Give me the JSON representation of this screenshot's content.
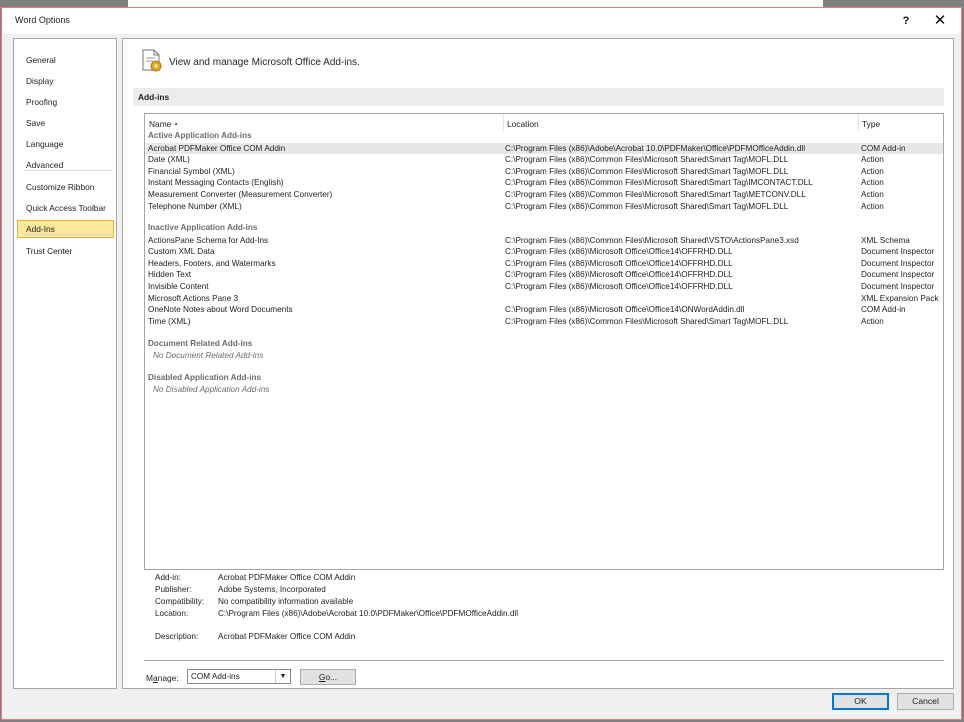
{
  "window": {
    "title": "Word Options",
    "help_glyph": "?",
    "close_glyph": "✕"
  },
  "nav": {
    "items": [
      {
        "label": "General",
        "selected": false
      },
      {
        "label": "Display",
        "selected": false
      },
      {
        "label": "Proofing",
        "selected": false
      },
      {
        "label": "Save",
        "selected": false
      },
      {
        "label": "Language",
        "selected": false
      },
      {
        "label": "Advanced",
        "selected": false
      },
      {
        "label": "Customize Ribbon",
        "selected": false
      },
      {
        "label": "Quick Access Toolbar",
        "selected": false
      },
      {
        "label": "Add-Ins",
        "selected": true
      },
      {
        "label": "Trust Center",
        "selected": false
      }
    ]
  },
  "header": {
    "text": "View and manage Microsoft Office Add-ins.",
    "icon": "addins-gear-document-icon"
  },
  "section": {
    "title": "Add-ins"
  },
  "list": {
    "columns": {
      "name": "Name",
      "sort_glyph": "▲",
      "location": "Location",
      "type": "Type"
    },
    "groups": [
      {
        "title": "Active Application Add-ins",
        "rows": [
          {
            "name": "Acrobat PDFMaker Office COM Addin",
            "location": "C:\\Program Files (x86)\\Adobe\\Acrobat 10.0\\PDFMaker\\Office\\PDFMOfficeAddin.dll",
            "type": "COM Add-in",
            "selected": true
          },
          {
            "name": "Date (XML)",
            "location": "C:\\Program Files (x86)\\Common Files\\Microsoft Shared\\Smart Tag\\MOFL.DLL",
            "type": "Action"
          },
          {
            "name": "Financial Symbol (XML)",
            "location": "C:\\Program Files (x86)\\Common Files\\Microsoft Shared\\Smart Tag\\MOFL.DLL",
            "type": "Action"
          },
          {
            "name": "Instant Messaging Contacts (English)",
            "location": "C:\\Program Files (x86)\\Common Files\\Microsoft Shared\\Smart Tag\\IMCONTACT.DLL",
            "type": "Action"
          },
          {
            "name": "Measurement Converter (Measurement Converter)",
            "location": "C:\\Program Files (x86)\\Common Files\\Microsoft Shared\\Smart Tag\\METCONV.DLL",
            "type": "Action"
          },
          {
            "name": "Telephone Number (XML)",
            "location": "C:\\Program Files (x86)\\Common Files\\Microsoft Shared\\Smart Tag\\MOFL.DLL",
            "type": "Action"
          }
        ]
      },
      {
        "title": "Inactive Application Add-ins",
        "rows": [
          {
            "name": "ActionsPane Schema for Add-Ins",
            "location": "C:\\Program Files (x86)\\Common Files\\Microsoft Shared\\VSTO\\ActionsPane3.xsd",
            "type": "XML Schema"
          },
          {
            "name": "Custom XML Data",
            "location": "C:\\Program Files (x86)\\Microsoft Office\\Office14\\OFFRHD.DLL",
            "type": "Document Inspector"
          },
          {
            "name": "Headers, Footers, and Watermarks",
            "location": "C:\\Program Files (x86)\\Microsoft Office\\Office14\\OFFRHD.DLL",
            "type": "Document Inspector"
          },
          {
            "name": "Hidden Text",
            "location": "C:\\Program Files (x86)\\Microsoft Office\\Office14\\OFFRHD.DLL",
            "type": "Document Inspector"
          },
          {
            "name": "Invisible Content",
            "location": "C:\\Program Files (x86)\\Microsoft Office\\Office14\\OFFRHD.DLL",
            "type": "Document Inspector"
          },
          {
            "name": "Microsoft Actions Pane 3",
            "location": "",
            "type": "XML Expansion Pack"
          },
          {
            "name": "OneNote Notes about Word Documents",
            "location": "C:\\Program Files (x86)\\Microsoft Office\\Office14\\ONWordAddin.dll",
            "type": "COM Add-in"
          },
          {
            "name": "Time (XML)",
            "location": "C:\\Program Files (x86)\\Common Files\\Microsoft Shared\\Smart Tag\\MOFL.DLL",
            "type": "Action"
          }
        ]
      },
      {
        "title": "Document Related Add-ins",
        "empty_note": "No Document Related Add-ins",
        "rows": []
      },
      {
        "title": "Disabled Application Add-ins",
        "empty_note": "No Disabled Application Add-ins",
        "rows": []
      }
    ]
  },
  "details": {
    "addin_label": "Add-in:",
    "addin_value": "Acrobat PDFMaker Office COM Addin",
    "publisher_label": "Publisher:",
    "publisher_value": "Adobe Systems, Incorporated",
    "compat_label": "Compatibility:",
    "compat_value": "No compatibility information available",
    "location_label": "Location:",
    "location_value": "C:\\Program Files (x86)\\Adobe\\Acrobat 10.0\\PDFMaker\\Office\\PDFMOfficeAddin.dll",
    "description_label": "Description:",
    "description_value": "Acrobat PDFMaker Office COM Addin"
  },
  "manage": {
    "label_pre": "M",
    "label_accel": "a",
    "label_post": "nage:",
    "selected": "COM Add-ins",
    "go_accel": "G",
    "go_post": "o..."
  },
  "buttons": {
    "ok": "OK",
    "cancel": "Cancel"
  },
  "colors": {
    "selected_nav_bg": "#fce89a",
    "selected_nav_border": "#e3b53c",
    "default_button_border": "#0078d7",
    "dialog_border": "#e57f7f"
  }
}
